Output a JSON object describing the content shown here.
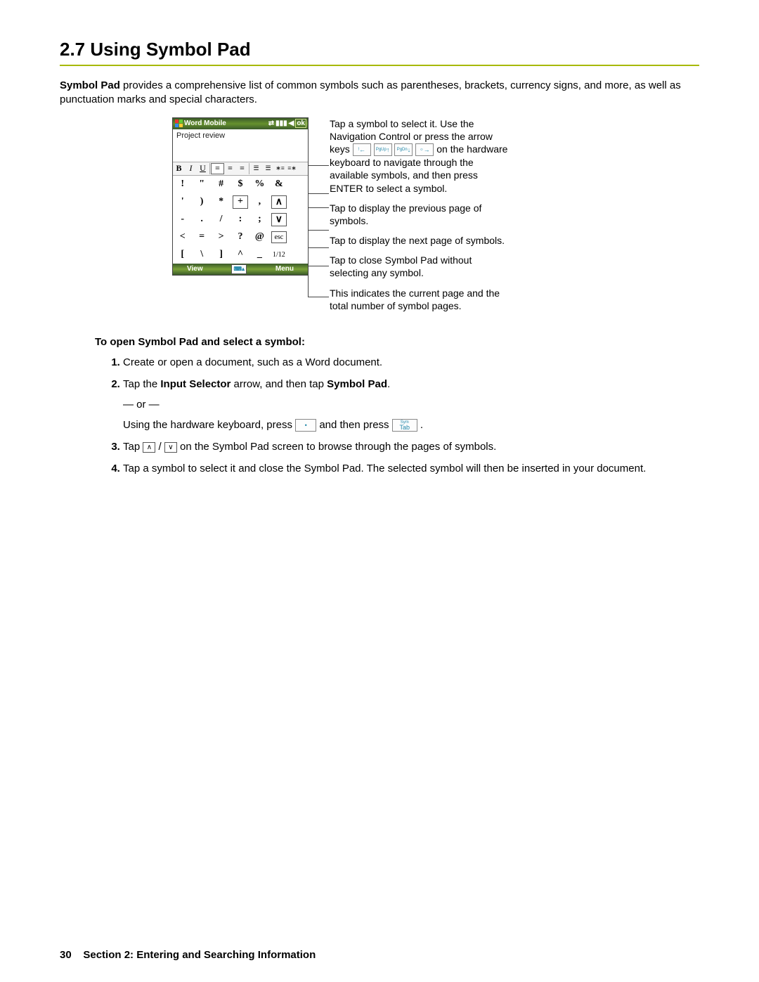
{
  "heading": "2.7  Using Symbol Pad",
  "intro_bold": "Symbol Pad",
  "intro_rest": " provides a comprehensive list of common symbols such as parentheses, brackets, currency signs, and more, as well as punctuation marks and special characters.",
  "phone": {
    "title": "Word Mobile",
    "status_ok": "ok",
    "doc_text": "Project review",
    "toolbar": {
      "b": "B",
      "i": "I",
      "u": "U"
    },
    "symbols": [
      [
        "!",
        "\"",
        "#",
        "$",
        "%",
        "&",
        ""
      ],
      [
        "'",
        ")",
        "*",
        "+",
        ",",
        "",
        ""
      ],
      [
        "-",
        ".",
        "/",
        ":",
        ";",
        "",
        ""
      ],
      [
        "<",
        "=",
        ">",
        "?",
        "@",
        "",
        ""
      ],
      [
        "[",
        "\\",
        "]",
        "^",
        "_",
        "",
        ""
      ]
    ],
    "prev_icon": "∧",
    "next_icon": "∨",
    "esc": "esc",
    "pager": "1/12",
    "bottom_left": "View",
    "bottom_right": "Menu"
  },
  "callouts": {
    "c1a": "Tap a symbol to select it. Use the Navigation Control or press the arrow keys ",
    "c1b": " on the hardware keyboard to navigate through the available symbols, and then press ENTER to select a symbol.",
    "c2": "Tap to display the previous page of symbols.",
    "c3": "Tap to display the next page of symbols.",
    "c4": "Tap to close Symbol Pad without selecting any symbol.",
    "c5": "This indicates the current page and the total number of symbol pages."
  },
  "keys": {
    "left": "←",
    "pgup_top": "PgUp",
    "pgup": "↑",
    "pgdn_top": "PgDn",
    "pgdn": "↓",
    "right": "→",
    "dot": "•",
    "sym_top": "Sym",
    "sym": "Tab"
  },
  "subhead": "To open Symbol Pad and select a symbol:",
  "steps": {
    "s1": "Create or open a document, such as a Word document.",
    "s2a": "Tap the ",
    "s2b": "Input Selector",
    "s2c": " arrow, and then tap ",
    "s2d": "Symbol Pad",
    "s2e": ".",
    "or": "— or —",
    "s2f": "Using the hardware keyboard, press ",
    "s2g": " and then press ",
    "s2h": " .",
    "s3a": "Tap ",
    "s3b": " / ",
    "s3c": " on the Symbol Pad screen to browse through the pages of symbols.",
    "s4": "Tap a symbol to select it and close the Symbol Pad. The selected symbol will then be inserted in your document."
  },
  "footer_page": "30",
  "footer_text": "Section 2: Entering and Searching Information"
}
